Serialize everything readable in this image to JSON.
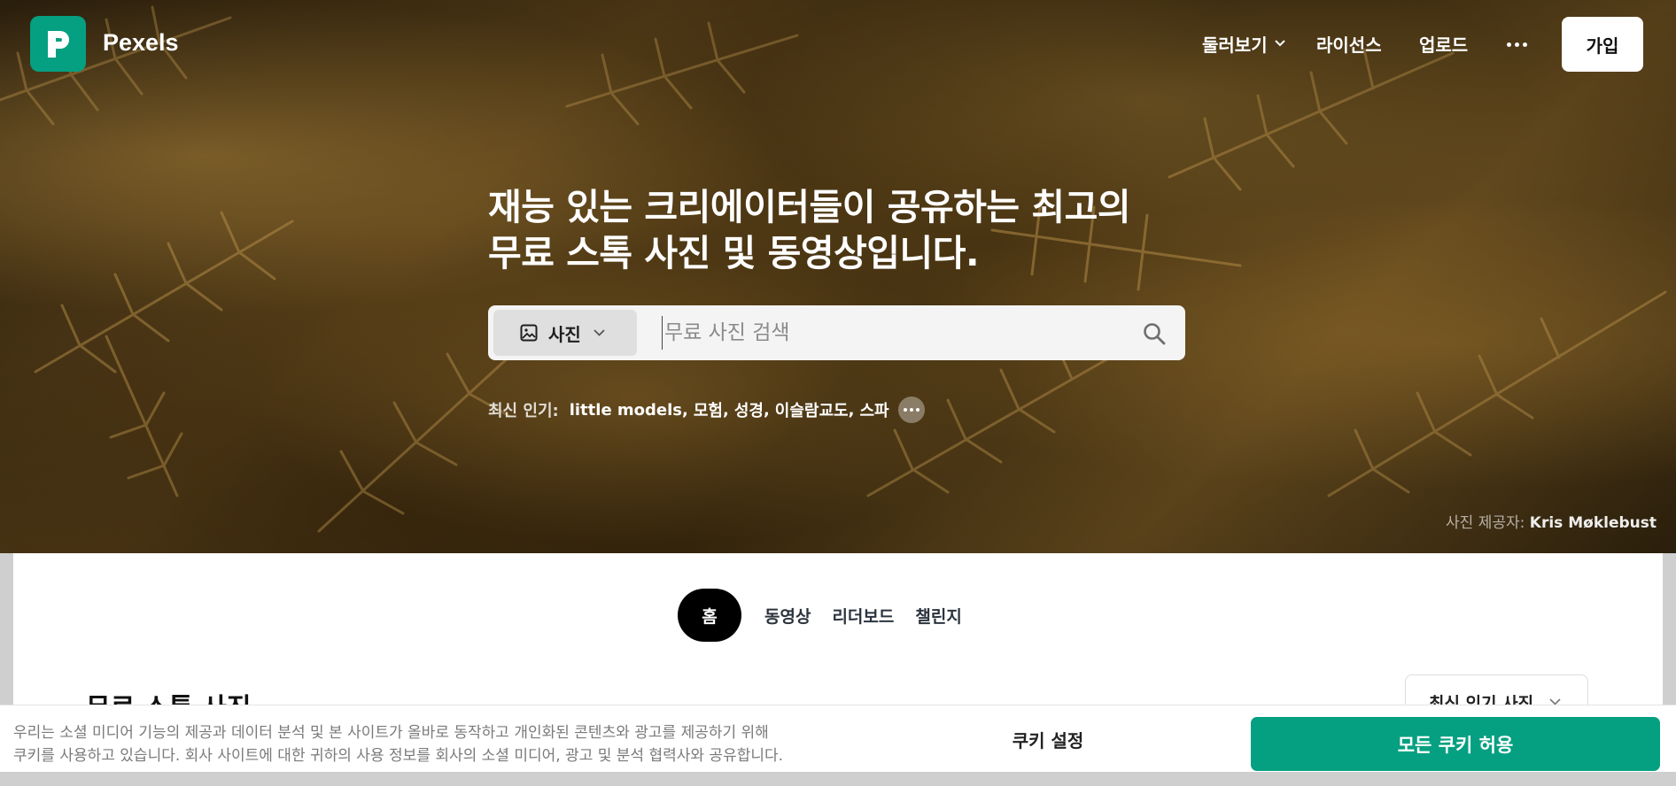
{
  "brand": {
    "name": "Pexels",
    "accent": "#05a081"
  },
  "nav": {
    "explore_label": "둘러보기",
    "license_label": "라이선스",
    "upload_label": "업로드",
    "join_label": "가입"
  },
  "hero": {
    "headline_line1": "재능 있는 크리에이터들이 공유하는 최고의",
    "headline_line2": "무료 스톡 사진 및 동영상입니다.",
    "search": {
      "type_label": "사진",
      "placeholder": "무료 사진 검색"
    },
    "trending": {
      "label": "최신 인기:",
      "tags": [
        "little models",
        "모험",
        "성경",
        "이슬람교도",
        "스파"
      ]
    },
    "credit_prefix": "사진 제공자:",
    "credit_name": "Kris Møklebust"
  },
  "tabs": [
    {
      "label": "홈",
      "active": true
    },
    {
      "label": "동영상",
      "active": false
    },
    {
      "label": "리더보드",
      "active": false
    },
    {
      "label": "챌린지",
      "active": false
    }
  ],
  "section": {
    "title": "무료 스톡 사진",
    "sort_label": "최신 인기 사진"
  },
  "cookie": {
    "text_line1": "우리는 소셜 미디어 기능의 제공과 데이터 분석 및 본 사이트가 올바로 동작하고 개인화된 콘텐츠와 광고를 제공하기 위해",
    "text_line2": "쿠키를 사용하고 있습니다. 회사 사이트에 대한 귀하의 사용 정보를 회사의 소셜 미디어, 광고 및 분석 협력사와 공유합니다.",
    "settings_label": "쿠키 설정",
    "accept_label": "모든 쿠키 허용"
  }
}
